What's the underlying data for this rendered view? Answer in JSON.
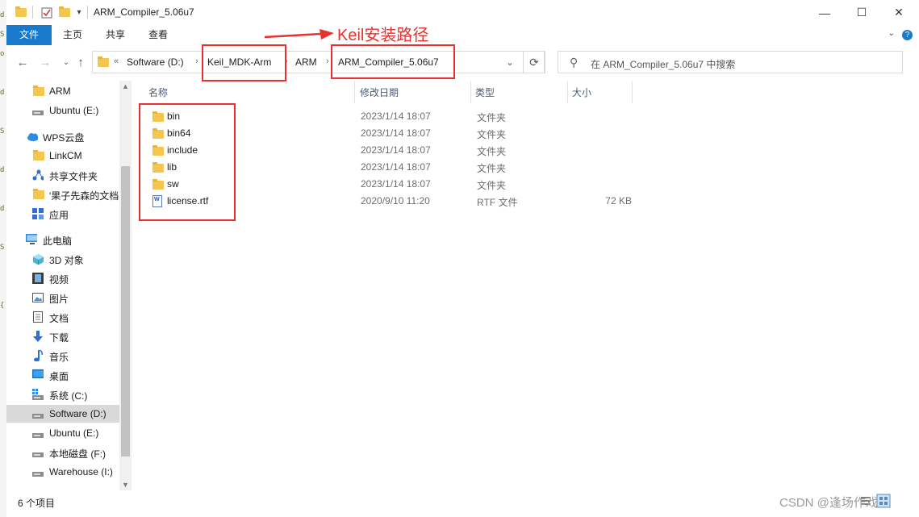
{
  "window": {
    "title": "ARM_Compiler_5.06u7",
    "minimize_glyph": "—",
    "maximize_glyph": "☐",
    "close_glyph": "✕"
  },
  "ribbon": {
    "tabs": [
      {
        "label": "文件",
        "active": true
      },
      {
        "label": "主页",
        "active": false
      },
      {
        "label": "共享",
        "active": false
      },
      {
        "label": "查看",
        "active": false
      }
    ],
    "collapse_glyph": "⌄",
    "help_glyph": "?"
  },
  "nav": {
    "back_glyph": "←",
    "forward_glyph": "→",
    "recent_glyph": "⌄",
    "up_glyph": "↑"
  },
  "address": {
    "overflow": "«",
    "crumbs": [
      "Software (D:)",
      "Keil_MDK-Arm",
      "ARM",
      "ARM_Compiler_5.06u7"
    ],
    "separator": "›",
    "dropdown_glyph": "⌄",
    "refresh_glyph": "⟳"
  },
  "search": {
    "placeholder": "在 ARM_Compiler_5.06u7 中搜索",
    "icon_glyph": "⚲"
  },
  "sidebar": {
    "items": [
      {
        "label": "ARM",
        "icon": "folder-icon"
      },
      {
        "label": "Ubuntu (E:)",
        "icon": "drive-icon"
      },
      {
        "label": "WPS云盘",
        "icon": "cloud-icon"
      },
      {
        "label": "LinkCM",
        "icon": "folder-icon"
      },
      {
        "label": "共享文件夹",
        "icon": "share-icon"
      },
      {
        "label": "'果子先森的文档",
        "icon": "folder-icon"
      },
      {
        "label": "应用",
        "icon": "apps-icon"
      },
      {
        "label": "此电脑",
        "icon": "computer-icon"
      },
      {
        "label": "3D 对象",
        "icon": "cube-icon"
      },
      {
        "label": "视频",
        "icon": "video-icon"
      },
      {
        "label": "图片",
        "icon": "picture-icon"
      },
      {
        "label": "文档",
        "icon": "document-icon"
      },
      {
        "label": "下载",
        "icon": "download-icon"
      },
      {
        "label": "音乐",
        "icon": "music-icon"
      },
      {
        "label": "桌面",
        "icon": "desktop-icon"
      },
      {
        "label": "系统 (C:)",
        "icon": "system-drive-icon"
      },
      {
        "label": "Software (D:)",
        "icon": "drive-icon",
        "selected": true
      },
      {
        "label": "Ubuntu (E:)",
        "icon": "drive-icon"
      },
      {
        "label": "本地磁盘 (F:)",
        "icon": "drive-icon"
      },
      {
        "label": "Warehouse (I:)",
        "icon": "drive-icon"
      }
    ],
    "scroll_up_glyph": "▲",
    "scroll_down_glyph": "▼"
  },
  "columns": {
    "name": "名称",
    "date": "修改日期",
    "type": "类型",
    "size": "大小"
  },
  "files": [
    {
      "name": "bin",
      "date": "2023/1/14 18:07",
      "type": "文件夹",
      "size": "",
      "kind": "folder"
    },
    {
      "name": "bin64",
      "date": "2023/1/14 18:07",
      "type": "文件夹",
      "size": "",
      "kind": "folder"
    },
    {
      "name": "include",
      "date": "2023/1/14 18:07",
      "type": "文件夹",
      "size": "",
      "kind": "folder"
    },
    {
      "name": "lib",
      "date": "2023/1/14 18:07",
      "type": "文件夹",
      "size": "",
      "kind": "folder"
    },
    {
      "name": "sw",
      "date": "2023/1/14 18:07",
      "type": "文件夹",
      "size": "",
      "kind": "folder"
    },
    {
      "name": "license.rtf",
      "date": "2020/9/10 11:20",
      "type": "RTF 文件",
      "size": "72 KB",
      "kind": "rtf"
    }
  ],
  "status": {
    "count": "6 个项目"
  },
  "annotation": {
    "text": "Keil安装路径",
    "color": "#e8312f"
  },
  "watermark": "CSDN @逢场作戏",
  "colors": {
    "accent": "#1979ca",
    "folder": "#f4c64f",
    "selection": "#d9d9d9"
  }
}
